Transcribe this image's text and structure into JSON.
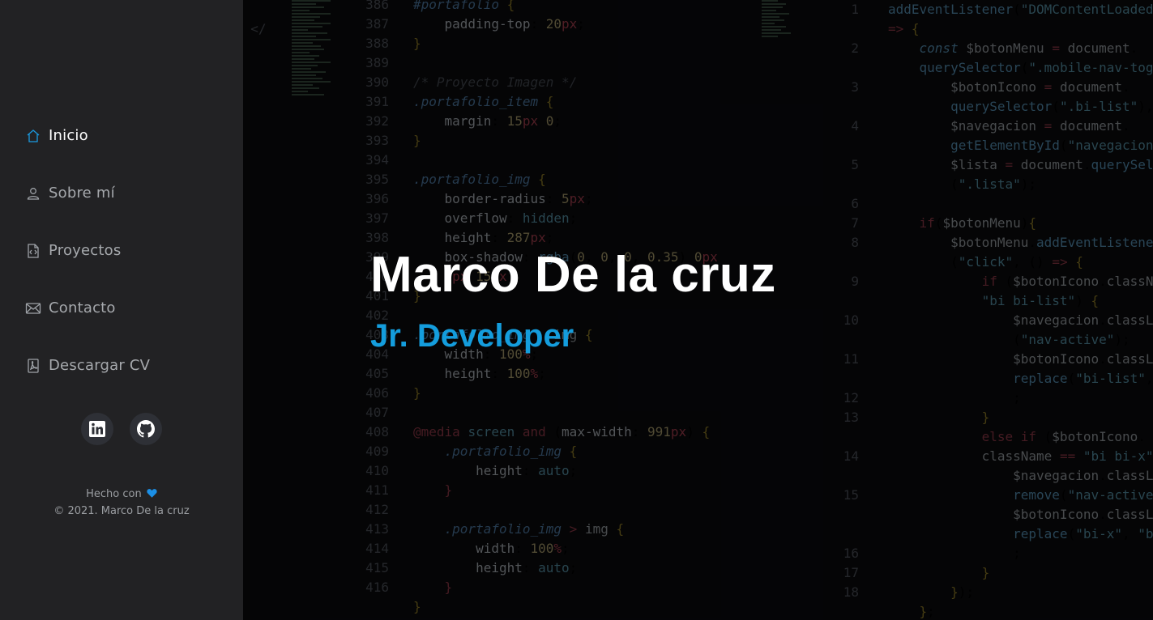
{
  "sidebar": {
    "nav": [
      {
        "label": "Inicio",
        "icon": "home-icon",
        "active": true
      },
      {
        "label": "Sobre mí",
        "icon": "user-icon"
      },
      {
        "label": "Proyectos",
        "icon": "code-file-icon"
      },
      {
        "label": "Contacto",
        "icon": "envelope-icon"
      },
      {
        "label": "Descargar CV",
        "icon": "pdf-file-icon"
      }
    ],
    "social": [
      {
        "name": "linkedin-icon"
      },
      {
        "name": "github-icon"
      }
    ],
    "credits": {
      "made_with": "Hecho con",
      "copyright": "© 2021. Marco De la cruz"
    }
  },
  "hero": {
    "name": "Marco De la cruz",
    "role": "Jr. Developer"
  },
  "colors": {
    "accent": "#149ddd",
    "sidebar_bg": "#222224"
  }
}
